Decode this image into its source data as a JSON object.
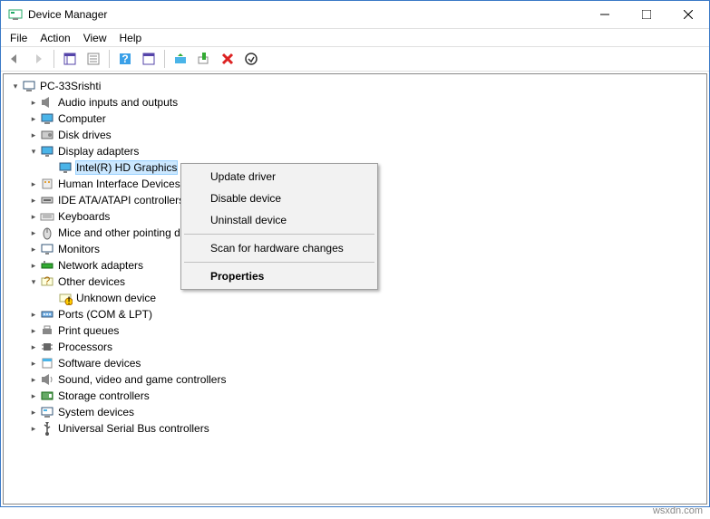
{
  "window": {
    "title": "Device Manager"
  },
  "menus": {
    "file": "File",
    "action": "Action",
    "view": "View",
    "help": "Help"
  },
  "root": "PC-33Srishti",
  "categories": [
    {
      "label": "Audio inputs and outputs",
      "icon": "audio"
    },
    {
      "label": "Computer",
      "icon": "computer"
    },
    {
      "label": "Disk drives",
      "icon": "disk"
    },
    {
      "label": "Display adapters",
      "icon": "display",
      "expanded": true,
      "children": [
        {
          "label": "Intel(R) HD Graphics",
          "icon": "display",
          "selected": true
        }
      ]
    },
    {
      "label": "Human Interface Devices",
      "icon": "hid"
    },
    {
      "label": "IDE ATA/ATAPI controllers",
      "icon": "ide"
    },
    {
      "label": "Keyboards",
      "icon": "keyboard"
    },
    {
      "label": "Mice and other pointing devices",
      "icon": "mouse"
    },
    {
      "label": "Monitors",
      "icon": "monitor"
    },
    {
      "label": "Network adapters",
      "icon": "network"
    },
    {
      "label": "Other devices",
      "icon": "other",
      "expanded": true,
      "children": [
        {
          "label": "Unknown device",
          "icon": "unknown"
        }
      ]
    },
    {
      "label": "Ports (COM & LPT)",
      "icon": "ports"
    },
    {
      "label": "Print queues",
      "icon": "printer"
    },
    {
      "label": "Processors",
      "icon": "cpu"
    },
    {
      "label": "Software devices",
      "icon": "software"
    },
    {
      "label": "Sound, video and game controllers",
      "icon": "sound"
    },
    {
      "label": "Storage controllers",
      "icon": "storage"
    },
    {
      "label": "System devices",
      "icon": "system"
    },
    {
      "label": "Universal Serial Bus controllers",
      "icon": "usb"
    }
  ],
  "context_menu": {
    "update": "Update driver",
    "disable": "Disable device",
    "uninstall": "Uninstall device",
    "scan": "Scan for hardware changes",
    "properties": "Properties"
  },
  "watermark": "wsxdn.com"
}
